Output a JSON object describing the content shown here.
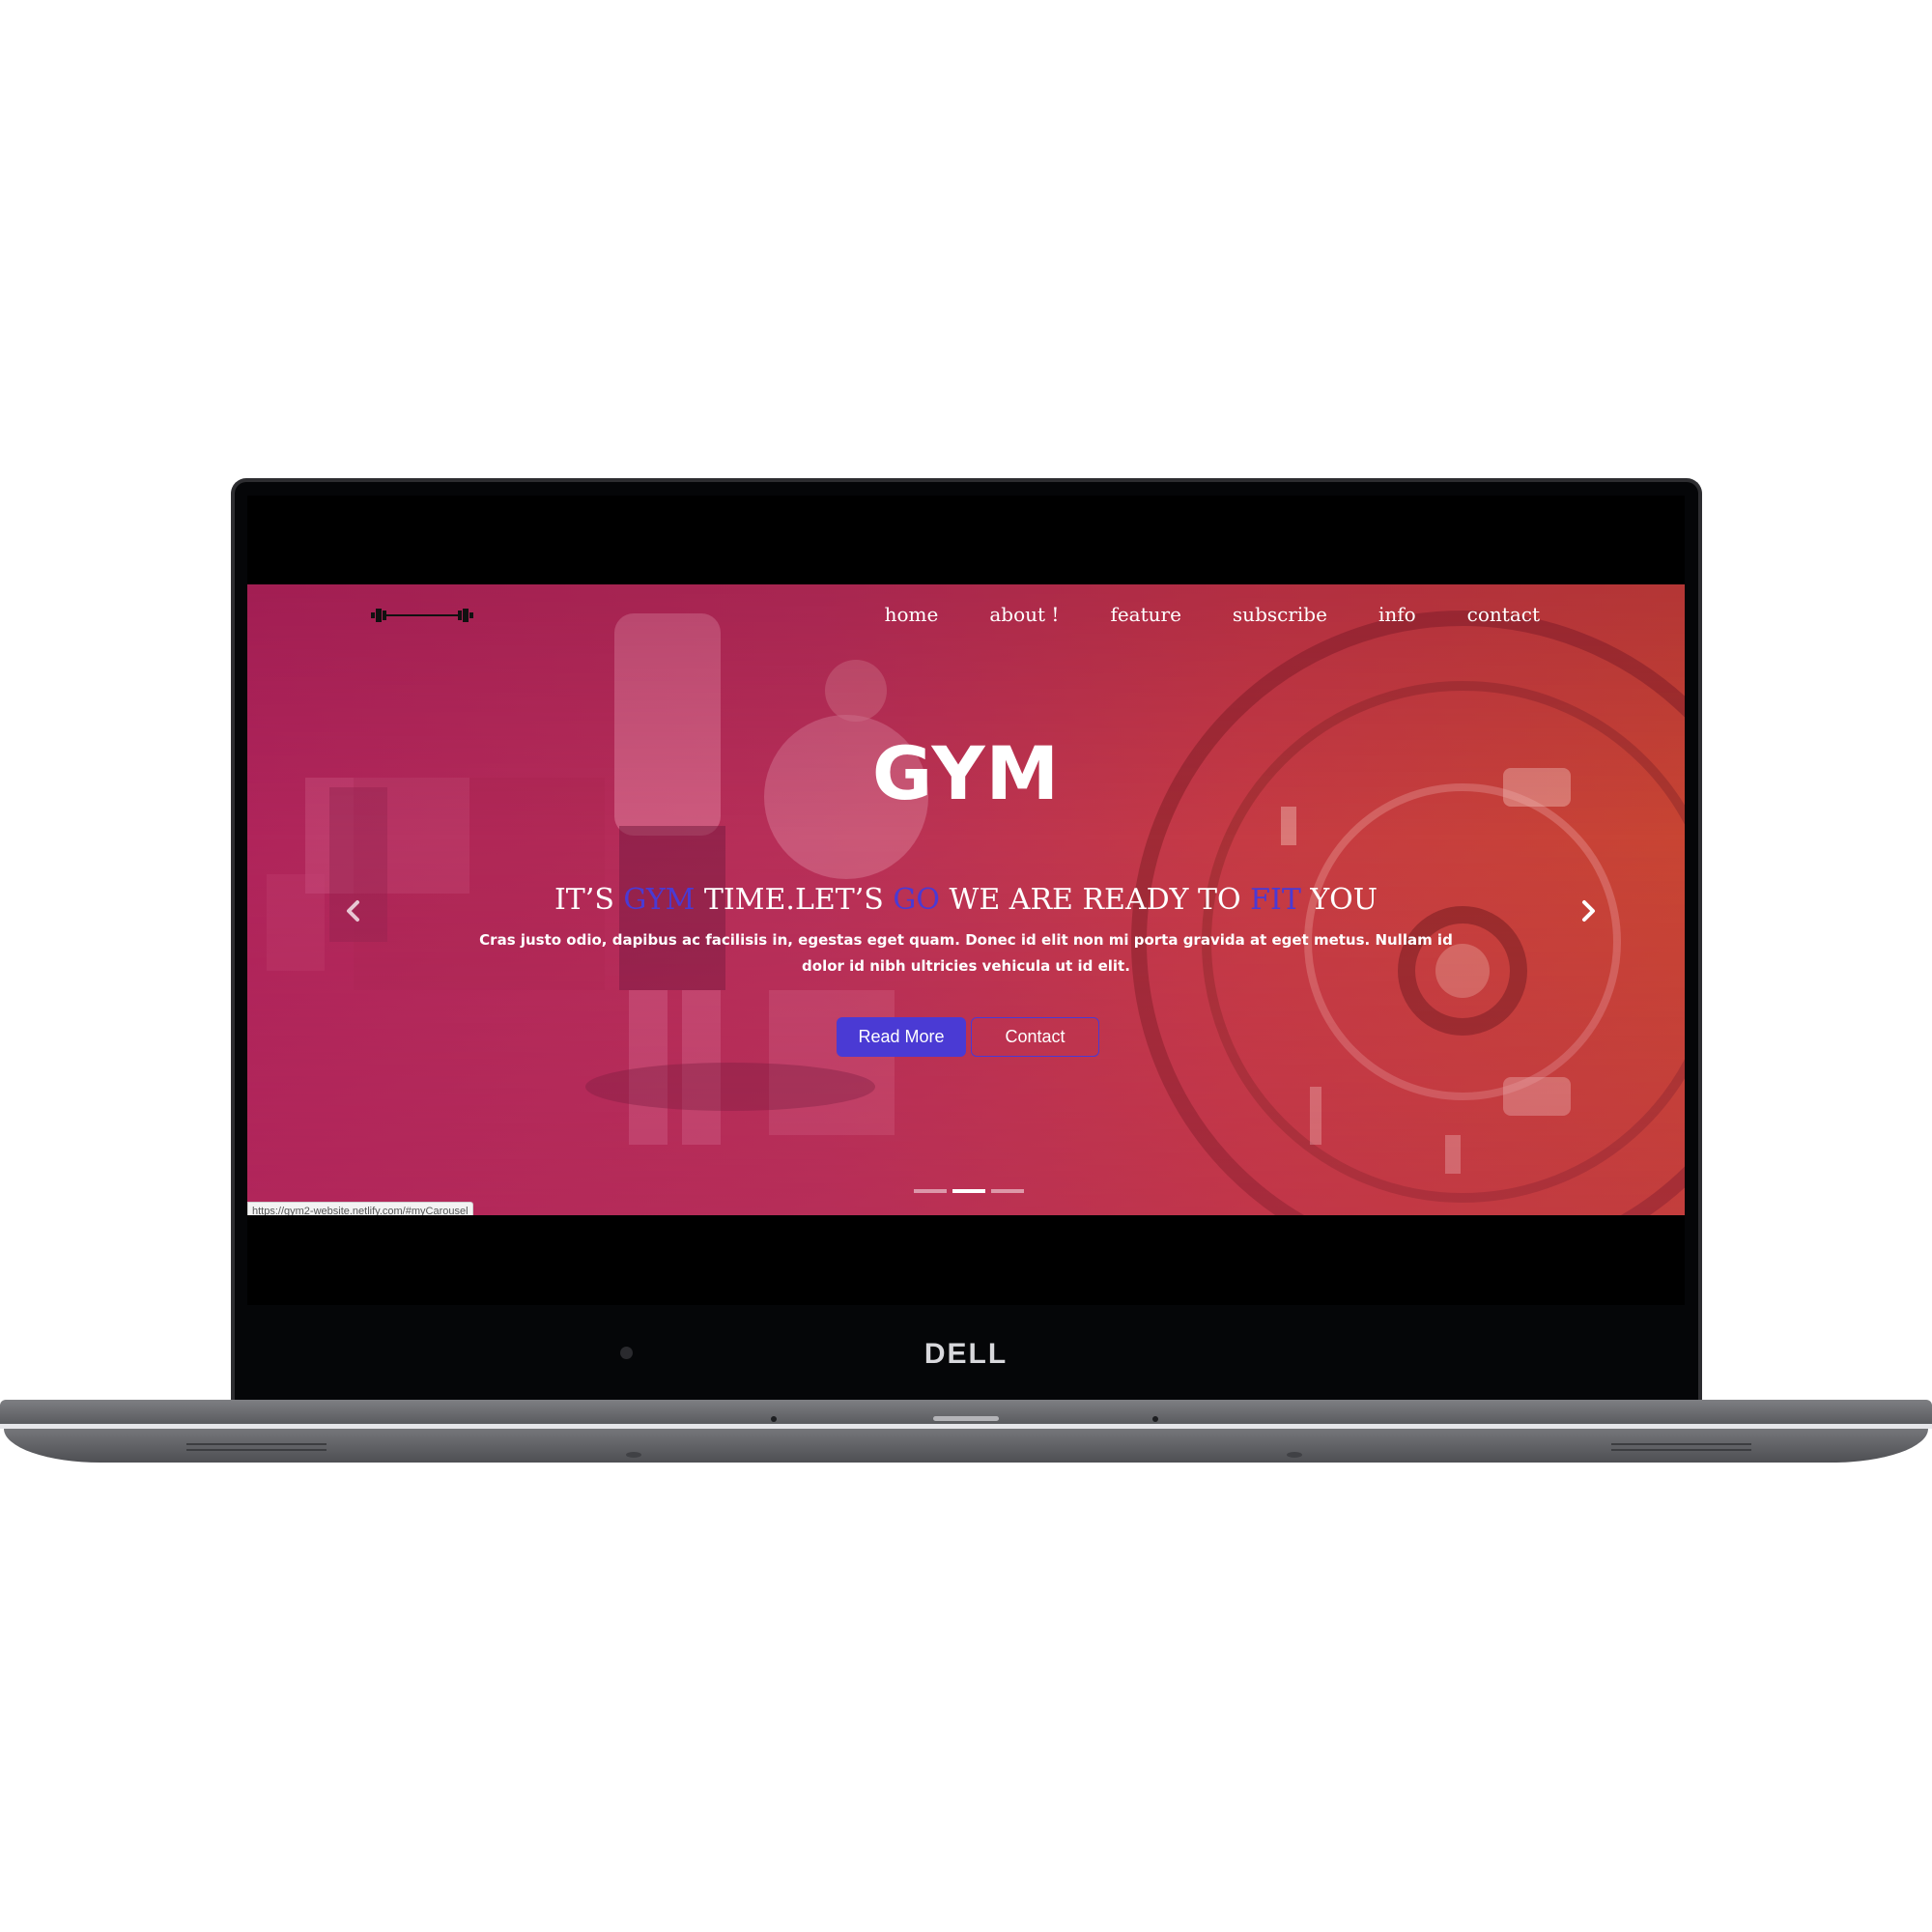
{
  "device": {
    "brand": "DELL"
  },
  "navbar": {
    "logo_icon": "barbell-icon",
    "items": [
      {
        "label": "home"
      },
      {
        "label": "about !"
      },
      {
        "label": "feature"
      },
      {
        "label": "subscribe"
      },
      {
        "label": "info"
      },
      {
        "label": "contact"
      }
    ]
  },
  "hero": {
    "title": "GYM",
    "tagline": {
      "part1": "IT’S ",
      "accent1": "GYM",
      "part2": " TIME.LET’S ",
      "accent2": "GO",
      "part3": " WE ARE READY TO ",
      "accent3": "FIT",
      "part4": " YOU"
    },
    "description": "Cras justo odio, dapibus ac facilisis in, egestas eget quam. Donec id elit non mi porta gravida at eget metus. Nullam id dolor id nibh ultricies vehicula ut id elit.",
    "primary_button": "Read More",
    "secondary_button": "Contact",
    "prev_icon": "chevron-left-icon",
    "next_icon": "chevron-right-icon",
    "slides_total": 3,
    "active_slide": 2
  },
  "status_bar": {
    "url": "https://gym2-website.netlify.com/#myCarousel"
  },
  "colors": {
    "accent": "#4a3ad4",
    "overlay_left": "#b0255b",
    "overlay_right": "#c84533"
  }
}
